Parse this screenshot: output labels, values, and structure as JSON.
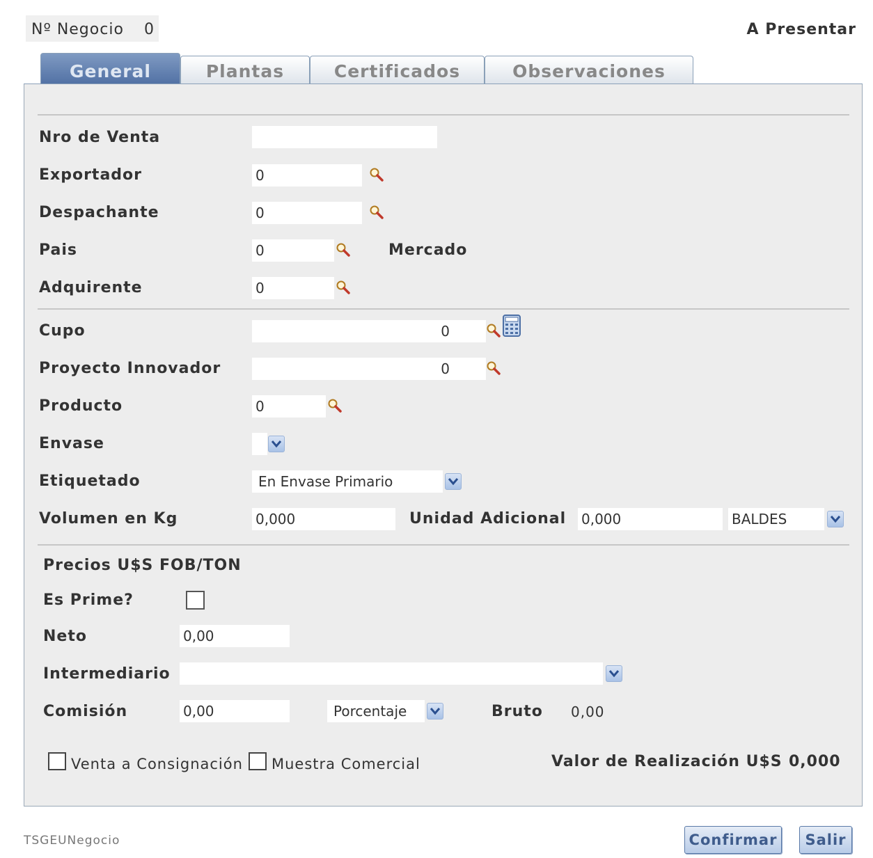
{
  "header": {
    "negocio_label": "Nº Negocio",
    "negocio_value": "0",
    "estado": "A Presentar"
  },
  "tabs": [
    {
      "label": "General",
      "active": true
    },
    {
      "label": "Plantas",
      "active": false
    },
    {
      "label": "Certificados",
      "active": false
    },
    {
      "label": "Observaciones",
      "active": false
    }
  ],
  "form": {
    "nro_venta": {
      "label": "Nro de Venta",
      "value": ""
    },
    "exportador": {
      "label": "Exportador",
      "value": "0"
    },
    "despachante": {
      "label": "Despachante",
      "value": "0"
    },
    "pais": {
      "label": "Pais",
      "value": "0",
      "mercado_label": "Mercado"
    },
    "adquirente": {
      "label": "Adquirente",
      "value": "0"
    },
    "cupo": {
      "label": "Cupo",
      "value": "0"
    },
    "proyecto": {
      "label": "Proyecto Innovador",
      "value": "0"
    },
    "producto": {
      "label": "Producto",
      "value": "0"
    },
    "envase": {
      "label": "Envase",
      "value": ""
    },
    "etiquetado": {
      "label": "Etiquetado",
      "value": "En Envase Primario"
    },
    "volumen": {
      "label": "Volumen en Kg",
      "value": "0,000",
      "unidad_label": "Unidad Adicional",
      "unidad_value": "0,000",
      "unidad_tipo": "BALDES"
    }
  },
  "precios": {
    "title": "Precios U$S FOB/TON",
    "es_prime_label": "Es Prime?",
    "es_prime_checked": false,
    "neto_label": "Neto",
    "neto_value": "0,00",
    "intermediario_label": "Intermediario",
    "intermediario_value": "",
    "comision_label": "Comisión",
    "comision_value": "0,00",
    "comision_tipo": "Porcentaje",
    "bruto_label": "Bruto",
    "bruto_value": "0,00",
    "consignacion_label": "Venta a Consignación",
    "consignacion_checked": false,
    "muestra_label": "Muestra Comercial",
    "muestra_checked": false,
    "valor_label": "Valor de Realización U$S",
    "valor_value": "0,000"
  },
  "footer": {
    "form_id": "TSGEUNegocio",
    "confirmar": "Confirmar",
    "salir": "Salir"
  },
  "icons": {
    "search": "magnifier-icon",
    "calculator": "calculator-icon",
    "dropdown": "chevron-down-icon"
  },
  "colors": {
    "tab_active": "#5a78aa",
    "panel_bg": "#ededed",
    "button_text": "#3f5c8c"
  }
}
